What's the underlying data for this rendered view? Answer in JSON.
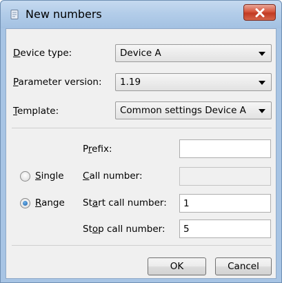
{
  "window": {
    "title": "New numbers",
    "close_symbol": "✕",
    "app_icon": "document-icon"
  },
  "form": {
    "device_type": {
      "label_mnemonic": "D",
      "label_rest": "evice type:",
      "value": "Device A"
    },
    "parameter_version": {
      "label_mnemonic": "P",
      "label_rest": "arameter version:",
      "value": "1.19"
    },
    "template": {
      "label_mnemonic": "T",
      "label_rest": "emplate:",
      "value": "Common settings Device A"
    },
    "prefix": {
      "label_pre": "P",
      "label_mnemonic": "r",
      "label_rest": "efix:",
      "value": ""
    },
    "mode_single": {
      "label_mnemonic": "S",
      "label_rest": "ingle",
      "checked": false
    },
    "mode_range": {
      "label_mnemonic": "R",
      "label_rest": "ange",
      "checked": true
    },
    "call_number": {
      "label_mnemonic": "C",
      "label_rest": "all number:",
      "value": ""
    },
    "start_call_number": {
      "label_pre": "St",
      "label_mnemonic": "a",
      "label_rest": "rt call number:",
      "value": "1"
    },
    "stop_call_number": {
      "label_pre": "St",
      "label_mnemonic": "o",
      "label_rest": "p call number:",
      "value": "5"
    }
  },
  "buttons": {
    "ok": "OK",
    "cancel": "Cancel"
  }
}
